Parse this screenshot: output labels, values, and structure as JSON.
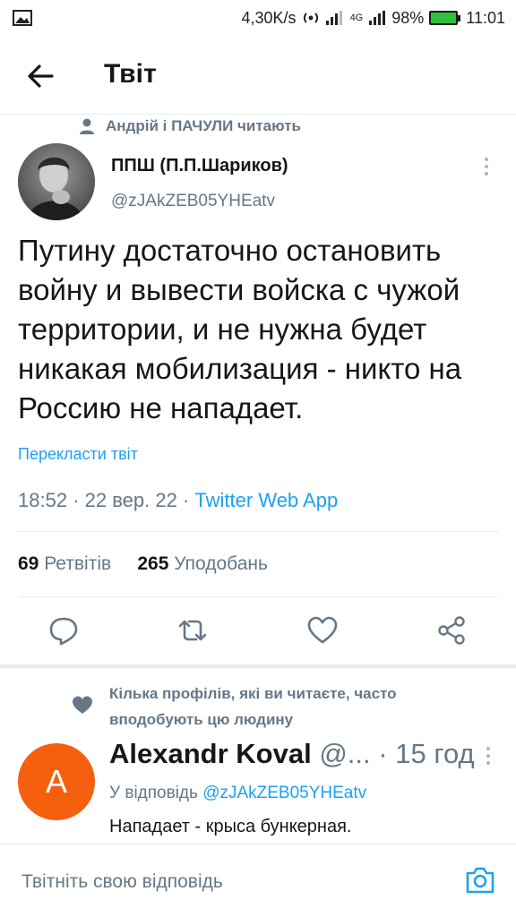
{
  "status_bar": {
    "network_speed": "4,30K/s",
    "network_type": "4G",
    "battery": "98%",
    "time": "11:01",
    "icons": [
      "image-icon",
      "hotspot-icon",
      "signal-icon",
      "battery-icon"
    ]
  },
  "header": {
    "title": "Твіт"
  },
  "social_context": {
    "text": "Андрій і ПАЧУЛИ читають"
  },
  "tweet": {
    "author_name": "ППШ (П.П.Шариков)",
    "author_handle": "@zJAkZEB05YHEatv",
    "text": "Путину достаточно остановить войну и вывести войска с чужой территории, и не нужна будет никакая мобилизация - никто на Россию не нападает.",
    "translate": "Перекласти твіт",
    "time": "18:52",
    "date": "22 вер. 22",
    "sep": "·",
    "source": "Twitter Web App",
    "retweets_count": "69",
    "retweets_label": "Ретвітів",
    "likes_count": "265",
    "likes_label": "Уподобань"
  },
  "suggestion": {
    "text": "Кілька профілів, які ви читаєте, часто вподобують цю людину"
  },
  "reply": {
    "avatar_letter": "A",
    "avatar_color": "#f5600f",
    "name": "Alexandr Koval",
    "handle": "@...",
    "sep": "·",
    "time": "15 год",
    "reply_to_label": "У відповідь",
    "reply_to_handle": "@zJAkZEB05YHEatv",
    "text": "Нападает - крыса бункерная."
  },
  "composer": {
    "placeholder": "Твітніть свою відповідь"
  },
  "colors": {
    "accent": "#1da1f2",
    "muted": "#657786",
    "text": "#14171a"
  }
}
